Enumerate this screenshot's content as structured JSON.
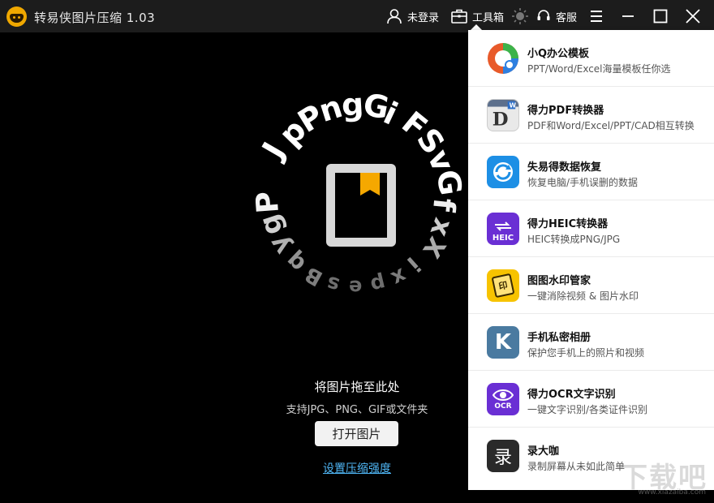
{
  "app": {
    "title": "转易侠图片压缩 1.03"
  },
  "titlebar": {
    "login_label": "未登录",
    "toolbox_label": "工具箱",
    "service_label": "客服"
  },
  "hero": {
    "ring_text": [
      "J",
      "p",
      "P",
      "n",
      "g",
      "G",
      "i",
      "F",
      "S",
      "v",
      "G",
      "f",
      "x",
      "X",
      "i",
      "x",
      "p",
      "e",
      "s",
      "B",
      "q",
      "y",
      "g",
      "P"
    ]
  },
  "drop": {
    "title": "将图片拖至此处",
    "subtitle": "支持JPG、PNG、GIF或文件夹",
    "open_button": "打开图片",
    "settings_link": "设置压缩强度"
  },
  "tools": [
    {
      "name": "小Q办公模板",
      "desc": "PPT/Word/Excel海量模板任你选",
      "icon": "xiaoq-office-icon"
    },
    {
      "name": "得力PDF转换器",
      "desc": "PDF和Word/Excel/PPT/CAD相互转换",
      "icon": "pdf-converter-icon"
    },
    {
      "name": "失易得数据恢复",
      "desc": "恢复电脑/手机误删的数据",
      "icon": "data-recovery-icon"
    },
    {
      "name": "得力HEIC转换器",
      "desc": "HEIC转换成PNG/JPG",
      "icon": "heic-converter-icon",
      "icon_text": "HEIC"
    },
    {
      "name": "图图水印管家",
      "desc": "一键消除视频 & 图片水印",
      "icon": "watermark-manager-icon",
      "icon_text": "印"
    },
    {
      "name": "手机私密相册",
      "desc": "保护您手机上的照片和视频",
      "icon": "private-album-icon",
      "icon_text": "K"
    },
    {
      "name": "得力OCR文字识别",
      "desc": "一键文字识别/各类证件识别",
      "icon": "ocr-icon",
      "icon_text": "OCR"
    },
    {
      "name": "录大咖",
      "desc": "录制屏幕从未如此简单",
      "icon": "screen-recorder-icon",
      "icon_text": "录"
    }
  ],
  "watermark": {
    "text": "下载吧",
    "url_text": "www.xiazaiba.com"
  },
  "colors": {
    "accent": "#f5a800",
    "link": "#4fb6f5",
    "titlebar": "#1c1c1c"
  }
}
